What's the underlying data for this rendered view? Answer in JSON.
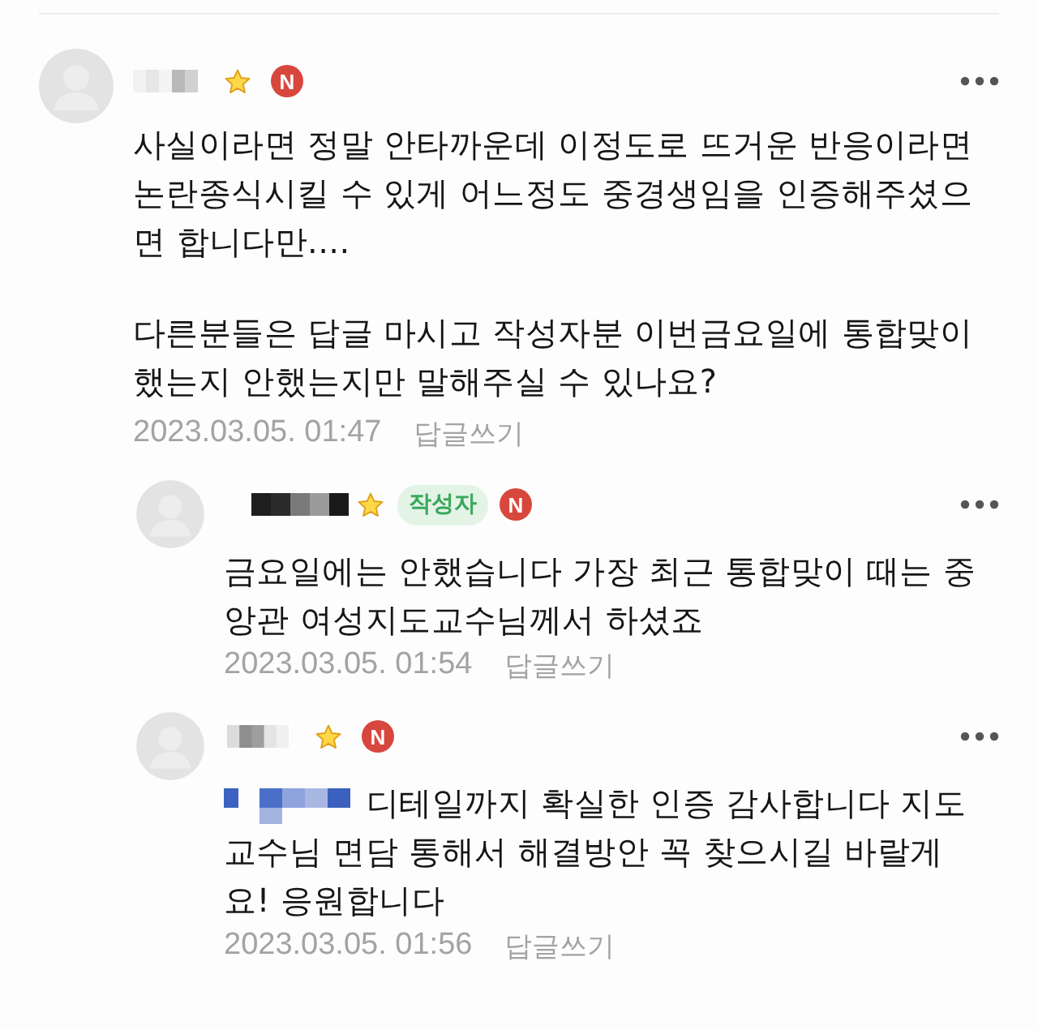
{
  "comments": [
    {
      "reply": false,
      "mention": false,
      "badge": "N",
      "paragraphs": [
        "사실이라면 정말 안타까운데 이정도로 뜨거운 반응이라면 논란종식시킬 수 있게 어느정도 중경생임을 인증해주셨으면 합니다만....",
        "다른분들은 답글 마시고 작성자분 이번금요일에 통합맞이 했는지 안했는지만 말해주실 수 있나요?"
      ],
      "date": "2023.03.05. 01:47",
      "reply_link": "답글쓰기"
    },
    {
      "reply": true,
      "mention": false,
      "author_tag": "작성자",
      "badge": "N",
      "paragraphs": [
        "금요일에는 안했습니다 가장 최근 통합맞이 때는 중앙관 여성지도교수님께서 하셨죠"
      ],
      "date": "2023.03.05. 01:54",
      "reply_link": "답글쓰기"
    },
    {
      "reply": true,
      "mention": true,
      "badge": "N",
      "paragraphs": [
        "디테일까지 확실한 인증 감사합니다 지도교수님 면담 통해서 해결방안 꼭 찾으시길 바랄게요! 응원합니다"
      ],
      "date": "2023.03.05. 01:56",
      "reply_link": "답글쓰기"
    }
  ]
}
